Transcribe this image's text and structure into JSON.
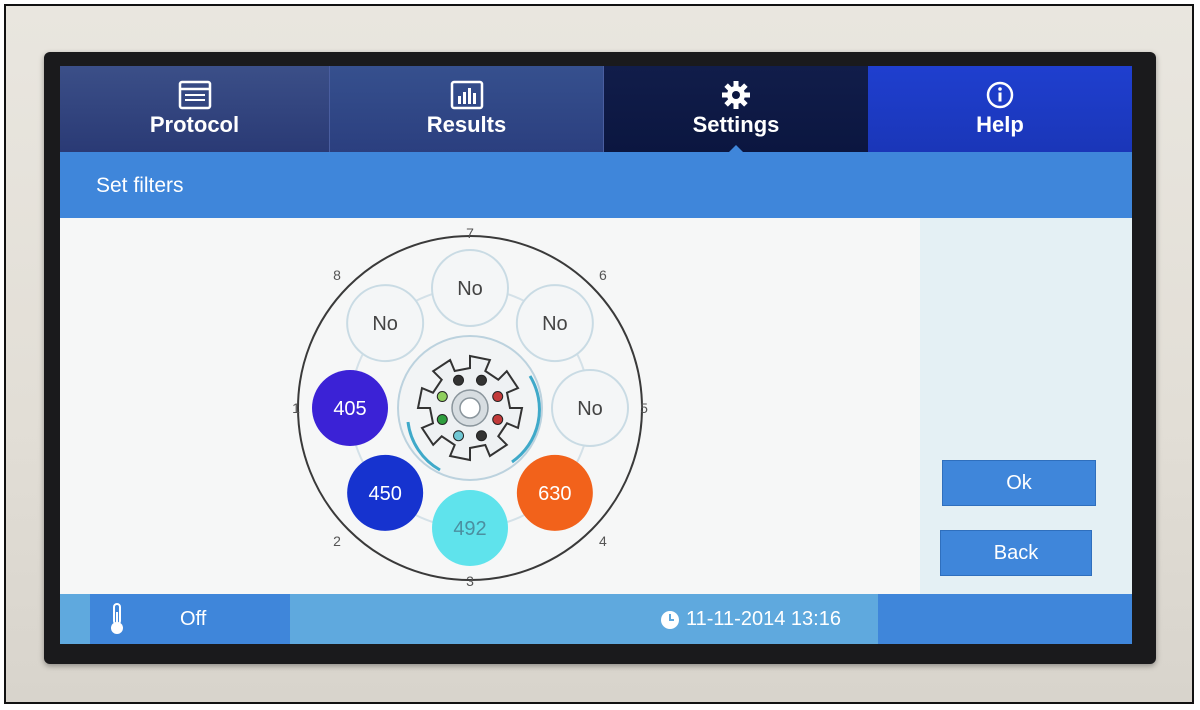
{
  "tabs": [
    {
      "label": "Protocol",
      "icon": "window-icon"
    },
    {
      "label": "Results",
      "icon": "bar-chart-icon"
    },
    {
      "label": "Settings",
      "icon": "gear-icon",
      "active": true
    },
    {
      "label": "Help",
      "icon": "info-icon"
    }
  ],
  "page": {
    "title": "Set filters"
  },
  "wheel": {
    "positions": [
      "1",
      "2",
      "3",
      "4",
      "5",
      "6",
      "7",
      "8"
    ],
    "slots": [
      {
        "position": "1",
        "label": "405",
        "color": "#3b22d6"
      },
      {
        "position": "2",
        "label": "450",
        "color": "#1633cf"
      },
      {
        "position": "3",
        "label": "492",
        "color": "#5fe3ec"
      },
      {
        "position": "4",
        "label": "630",
        "color": "#f2621b"
      },
      {
        "position": "5",
        "label": "No",
        "color": "#f4f6f7"
      },
      {
        "position": "6",
        "label": "No",
        "color": "#f4f6f7"
      },
      {
        "position": "7",
        "label": "No",
        "color": "#f4f6f7"
      },
      {
        "position": "8",
        "label": "No",
        "color": "#f4f6f7"
      }
    ]
  },
  "buttons": {
    "ok": "Ok",
    "back": "Back"
  },
  "status": {
    "temperature": "Off",
    "datetime": "11-11-2014 13:16"
  },
  "colors": {
    "accent": "#3f86da",
    "tab_active": "#0b1640",
    "tab_help": "#1a36b8"
  }
}
